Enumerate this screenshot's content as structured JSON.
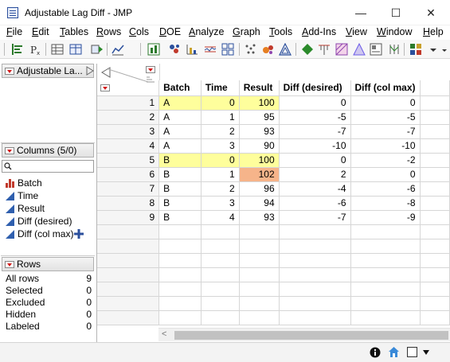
{
  "window": {
    "title": "Adjustable Lag Diff - JMP",
    "minimize": "—",
    "maximize": "☐",
    "close": "✕"
  },
  "menu": [
    "File",
    "Edit",
    "Tables",
    "Rows",
    "Cols",
    "DOE",
    "Analyze",
    "Graph",
    "Tools",
    "Add-Ins",
    "View",
    "Window",
    "Help"
  ],
  "table_panel": {
    "title": "Adjustable La..."
  },
  "columns_panel": {
    "title": "Columns (5/0)",
    "search_placeholder": "",
    "items": [
      {
        "label": "Batch",
        "type": "nominal"
      },
      {
        "label": "Time",
        "type": "continuous"
      },
      {
        "label": "Result",
        "type": "continuous"
      },
      {
        "label": "Diff (desired)",
        "type": "continuous"
      },
      {
        "label": "Diff (col max)",
        "type": "continuous"
      }
    ]
  },
  "rows_panel": {
    "title": "Rows",
    "stats": [
      {
        "label": "All rows",
        "value": "9"
      },
      {
        "label": "Selected",
        "value": "0"
      },
      {
        "label": "Excluded",
        "value": "0"
      },
      {
        "label": "Hidden",
        "value": "0"
      },
      {
        "label": "Labeled",
        "value": "0"
      }
    ]
  },
  "grid": {
    "columns": [
      "Batch",
      "Time",
      "Result",
      "Diff (desired)",
      "Diff (col max)"
    ],
    "rows": [
      {
        "n": "1",
        "cells": [
          "A",
          "0",
          "100",
          "0",
          "0"
        ]
      },
      {
        "n": "2",
        "cells": [
          "A",
          "1",
          "95",
          "-5",
          "-5"
        ]
      },
      {
        "n": "3",
        "cells": [
          "A",
          "2",
          "93",
          "-7",
          "-7"
        ]
      },
      {
        "n": "4",
        "cells": [
          "A",
          "3",
          "90",
          "-10",
          "-10"
        ]
      },
      {
        "n": "5",
        "cells": [
          "B",
          "0",
          "100",
          "0",
          "-2"
        ]
      },
      {
        "n": "6",
        "cells": [
          "B",
          "1",
          "102",
          "2",
          "0"
        ]
      },
      {
        "n": "7",
        "cells": [
          "B",
          "2",
          "96",
          "-4",
          "-6"
        ]
      },
      {
        "n": "8",
        "cells": [
          "B",
          "3",
          "94",
          "-6",
          "-8"
        ]
      },
      {
        "n": "9",
        "cells": [
          "B",
          "4",
          "93",
          "-7",
          "-9"
        ]
      }
    ],
    "highlight_color": "#fefe9c",
    "max_color": "#f6b48a"
  },
  "status": {
    "info_icon": "info-icon",
    "home_icon": "home-icon"
  }
}
